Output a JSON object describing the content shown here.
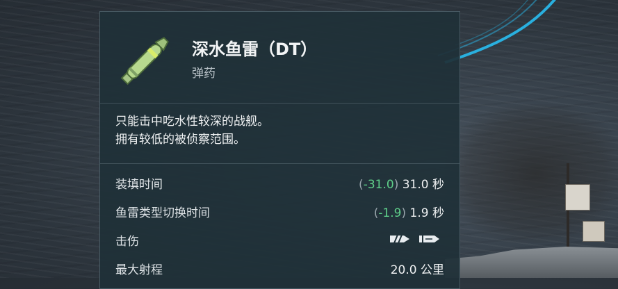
{
  "item": {
    "title": "深水鱼雷（DT）",
    "subtitle": "弹药",
    "icon": "torpedo-icon"
  },
  "description": [
    "只能击中吃水性较深的战舰。",
    "拥有较低的被侦察范围。"
  ],
  "stats": {
    "reload": {
      "label": "装填时间",
      "paren_open": "(",
      "delta": "-31.0",
      "paren_close": ")",
      "value": "31.0 秒"
    },
    "switch": {
      "label": "鱼雷类型切换时间",
      "paren_open": "(",
      "delta": "-1.9",
      "paren_close": ")",
      "value": "1.9 秒"
    },
    "damage": {
      "label": "击伤",
      "icons": [
        "damage-type-stripes-icon",
        "damage-type-arrow-icon"
      ]
    },
    "range": {
      "label": "最大射程",
      "value": "20.0 公里"
    }
  },
  "colors": {
    "bonus": "#5fd08a",
    "accent_ring": "#29b6e8",
    "panel": "#1f3038"
  }
}
